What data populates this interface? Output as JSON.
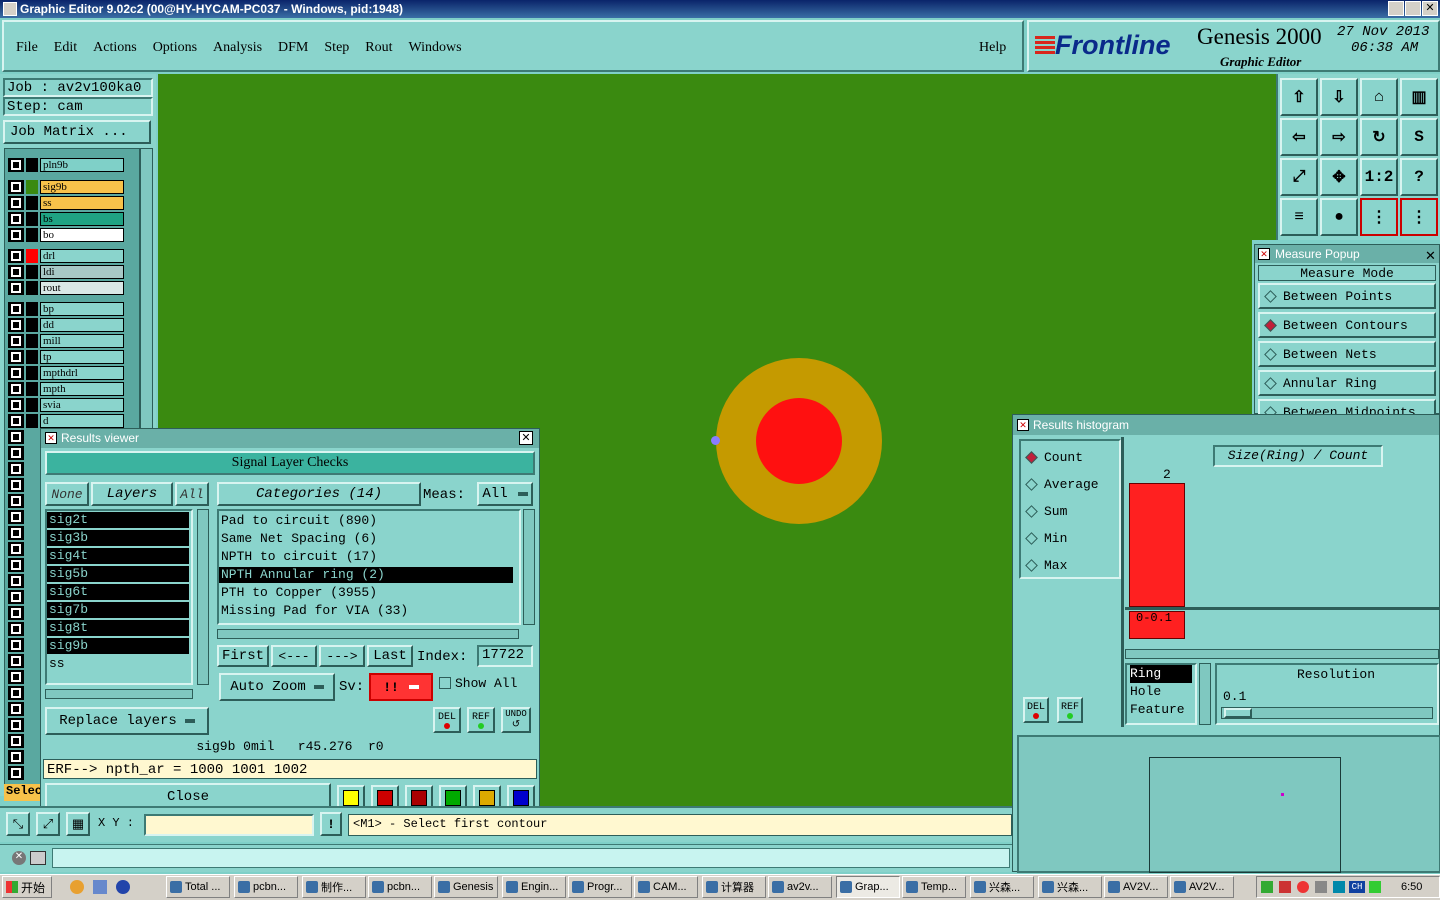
{
  "window": {
    "title": "Graphic Editor 9.02c2 (00@HY-HYCAM-PC037 - Windows, pid:1948)"
  },
  "menu": {
    "items": [
      "File",
      "Edit",
      "Actions",
      "Options",
      "Analysis",
      "DFM",
      "Step",
      "Rout",
      "Windows"
    ],
    "help": "Help"
  },
  "brand": {
    "logo": "Frontline",
    "product": "Genesis 2000",
    "subtitle": "Graphic Editor",
    "date": "27 Nov 2013",
    "time": "06:38 AM"
  },
  "job": {
    "job_label": "Job : av2v100ka0",
    "step_label": "Step: cam",
    "matrix_button": "Job Matrix ..."
  },
  "layers": [
    {
      "name": "pln9b",
      "color": "#7fd0c8"
    },
    {
      "name": "sig9b",
      "color": "#f7c24a"
    },
    {
      "name": "ss",
      "color": "#f7c24a"
    },
    {
      "name": "bs",
      "color": "#1fa383"
    },
    {
      "name": "bo",
      "color": "#ffffff"
    },
    {
      "name": "drl",
      "color": "#8ad4cc"
    },
    {
      "name": "ldi",
      "color": "#a8c8c6"
    },
    {
      "name": "rout",
      "color": "#d9e8e6"
    },
    {
      "name": "bp",
      "color": "#8ad4cc"
    },
    {
      "name": "dd",
      "color": "#8ad4cc"
    },
    {
      "name": "mill",
      "color": "#8ad4cc"
    },
    {
      "name": "tp",
      "color": "#8ad4cc"
    },
    {
      "name": "mpthdrl",
      "color": "#8ad4cc"
    },
    {
      "name": "mpth",
      "color": "#8ad4cc"
    },
    {
      "name": "svia",
      "color": "#8ad4cc"
    },
    {
      "name": "d",
      "color": "#8ad4cc"
    }
  ],
  "sel_label": "Selec",
  "results_viewer": {
    "title": "Results viewer",
    "heading": "Signal Layer Checks",
    "none_btn": "None",
    "layers_btn": "Layers",
    "all_btn": "All",
    "categories_btn": "Categories (14)",
    "meas_label": "Meas:",
    "meas_value": "All",
    "layer_list": [
      "sig2t",
      "sig3b",
      "sig4t",
      "sig5b",
      "sig6t",
      "sig7b",
      "sig8t",
      "sig9b",
      "ss"
    ],
    "categories": [
      "Pad to circuit (890)",
      "Same Net Spacing (6)",
      "NPTH to circuit (17)",
      "NPTH Annular ring (2)",
      "PTH to Copper (3955)",
      "Missing Pad for VIA (33)"
    ],
    "selected_category": 3,
    "nav": {
      "first": "First",
      "prev": "<---",
      "next": "--->",
      "last": "Last",
      "index_label": "Index:",
      "index_value": "17722"
    },
    "auto_zoom": "Auto Zoom",
    "sv_label": "Sv:",
    "sv_value": "!!",
    "show_all": "Show All",
    "replace_layers": "Replace layers",
    "del": "DEL",
    "ref": "REF",
    "undo": "UNDO",
    "info_line": "sig9b 0mil   r45.276  r0",
    "erf_line": "ERF--> npth_ar = 1000 1001 1002",
    "close": "Close"
  },
  "measure_popup": {
    "title": "Measure Popup",
    "mode_label": "Measure Mode",
    "options": [
      "Between Points",
      "Between Contours",
      "Between Nets",
      "Annular Ring",
      "Between Midpoints"
    ],
    "selected": 1
  },
  "histogram": {
    "title": "Results histogram",
    "options": [
      "Count",
      "Average",
      "Sum",
      "Min",
      "Max"
    ],
    "selected": 0,
    "chart_title": "Size(Ring) / Count",
    "bar_value": "2",
    "bar_label": "0-0.1",
    "types": [
      "Ring",
      "Hole",
      "Feature"
    ],
    "selected_type": 0,
    "resolution_label": "Resolution",
    "resolution_value": "0.1",
    "del": "DEL",
    "ref": "REF"
  },
  "status": {
    "xy_label": "X Y :",
    "prompt": "<M1> - Select first contour"
  },
  "taskbar": {
    "start": "开始",
    "items": [
      "Total ...",
      "pcbn...",
      "制作...",
      "pcbn...",
      "Genesis",
      "Engin...",
      "Progr...",
      "CAM...",
      "计算器",
      "av2v...",
      "Grap...",
      "Temp...",
      "兴森...",
      "兴森...",
      "AV2V...",
      "AV2V..."
    ],
    "clock": "6:50"
  },
  "colors": {
    "canvas": "#3a8a10",
    "ring": "#c59a00",
    "pad": "#ff1010",
    "panel": "#8ad4cc",
    "bar": "#ff2020"
  }
}
